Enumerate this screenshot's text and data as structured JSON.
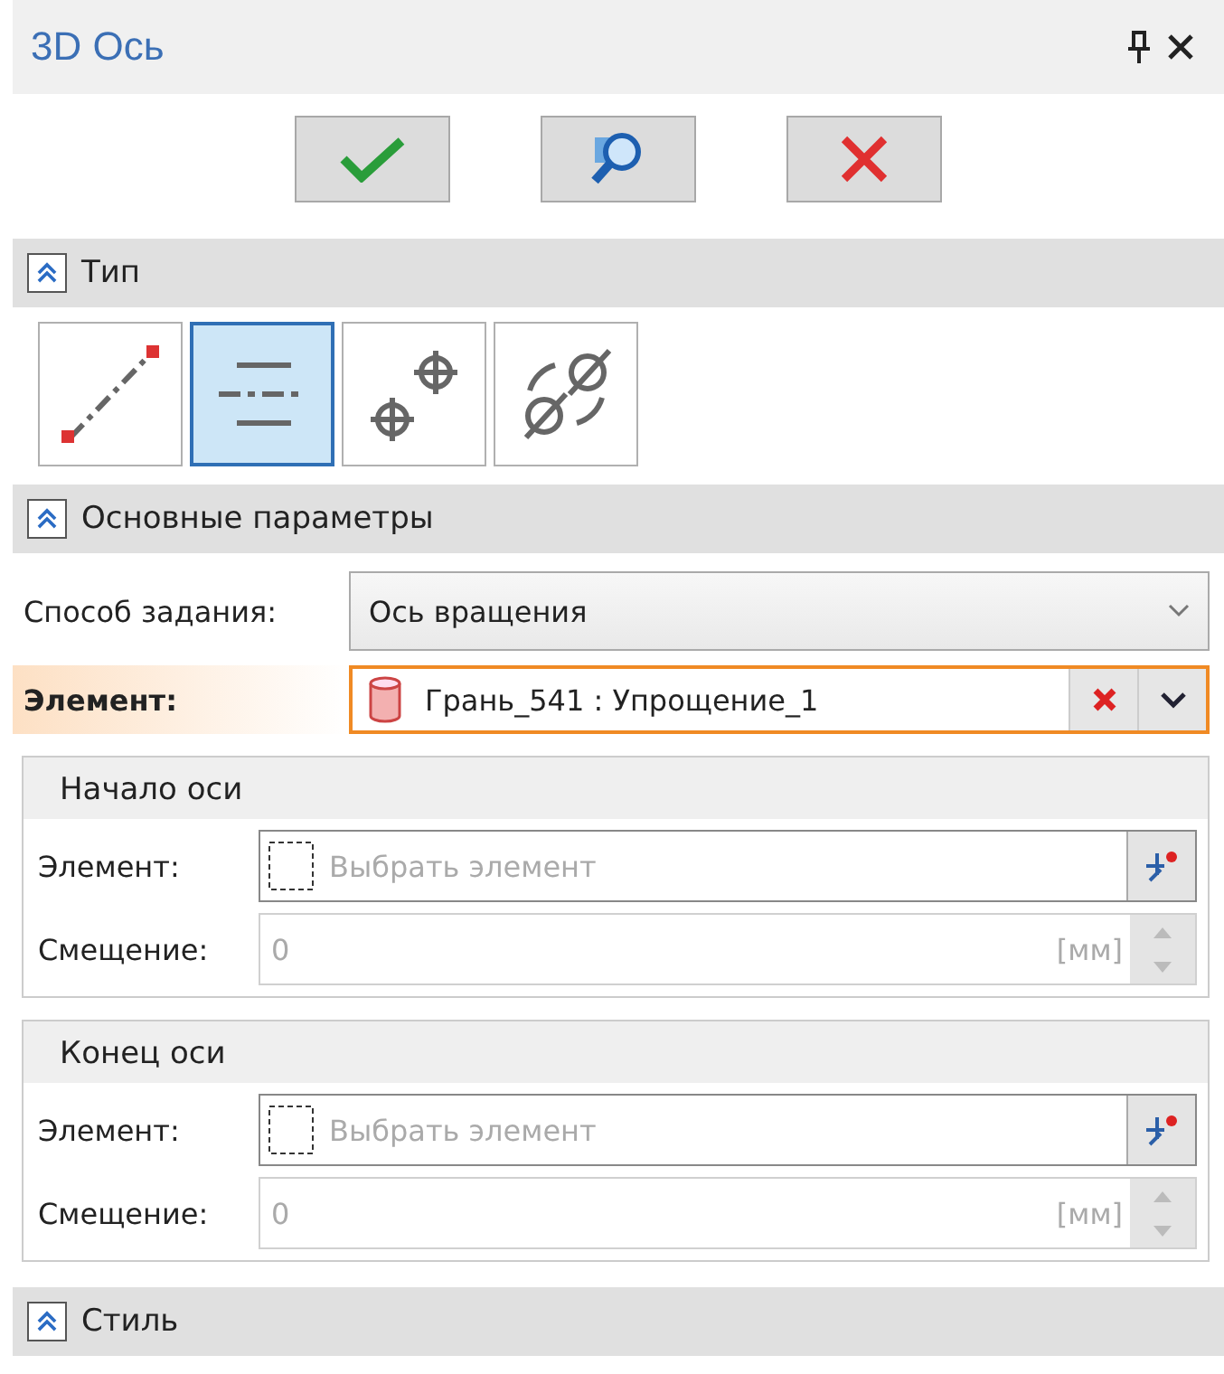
{
  "window": {
    "title": "3D Ось"
  },
  "toolbar": [
    {
      "kind": "ok"
    },
    {
      "kind": "preview"
    },
    {
      "kind": "cancel"
    }
  ],
  "sections": [
    {
      "kind": "types",
      "title": "Тип",
      "expanded": true,
      "types": [
        {
          "kind": "two-points",
          "selected": false
        },
        {
          "kind": "rotation-axis",
          "selected": true
        },
        {
          "kind": "two-centers",
          "selected": false
        },
        {
          "kind": "two-holes",
          "selected": false
        }
      ]
    },
    {
      "kind": "params",
      "title": "Основные параметры",
      "expanded": true,
      "method": {
        "label": "Способ задания:",
        "value": "Ось вращения"
      },
      "element": {
        "label": "Элемент:",
        "value": "Грань_541 : Упрощение_1",
        "active": true
      },
      "groups": [
        {
          "title": "Начало оси",
          "element_label": "Элемент:",
          "element_placeholder": "Выбрать элемент",
          "offset_label": "Смещение:",
          "offset_value": "0",
          "unit": "[мм]",
          "disabled": true
        },
        {
          "title": "Конец оси",
          "element_label": "Элемент:",
          "element_placeholder": "Выбрать элемент",
          "offset_label": "Смещение:",
          "offset_value": "0",
          "unit": "[мм]",
          "disabled": true
        }
      ]
    },
    {
      "kind": "style",
      "title": "Стиль",
      "expanded": true
    }
  ]
}
